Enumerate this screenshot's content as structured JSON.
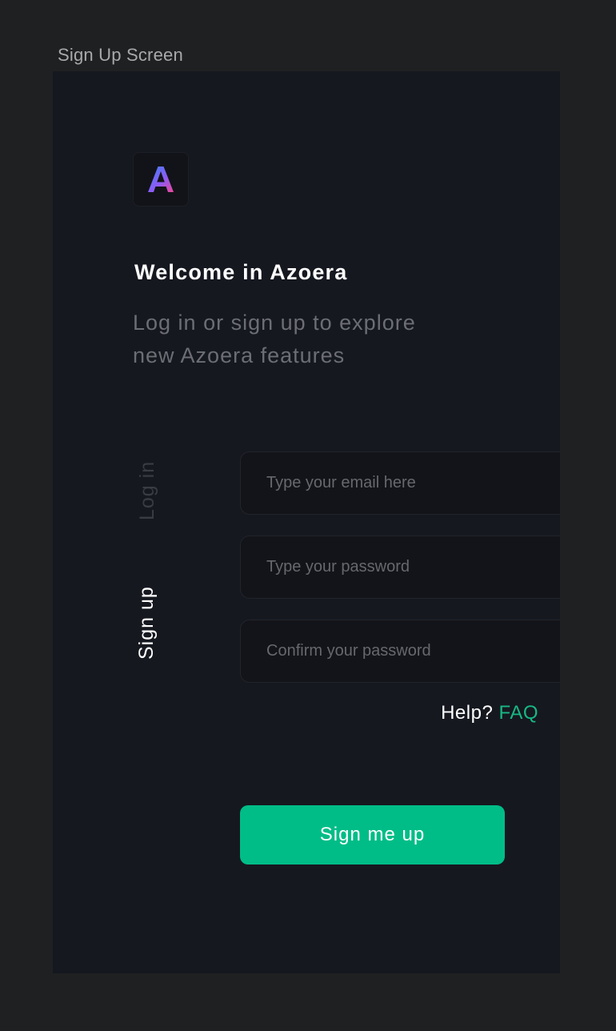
{
  "frame": {
    "title": "Sign Up Screen"
  },
  "brand": {
    "logo_letter": "A",
    "gradient": [
      "#4d7cf2",
      "#a855f7",
      "#ec4899"
    ]
  },
  "header": {
    "welcome": "Welcome in Azoera",
    "subtitle": "Log in or sign up to explore\nnew Azoera features"
  },
  "tabs": [
    {
      "label": "Log in",
      "active": false
    },
    {
      "label": "Sign up",
      "active": true
    }
  ],
  "form": {
    "email_placeholder": "Type your email here",
    "password_placeholder": "Type your password",
    "confirm_placeholder": "Confirm your password",
    "email_value": "",
    "password_value": "",
    "confirm_value": ""
  },
  "help": {
    "text": "Help?",
    "link": "FAQ"
  },
  "submit": {
    "label": "Sign me up"
  },
  "colors": {
    "accent": "#00bd87",
    "background": "#161820",
    "canvas": "#1f2021"
  }
}
